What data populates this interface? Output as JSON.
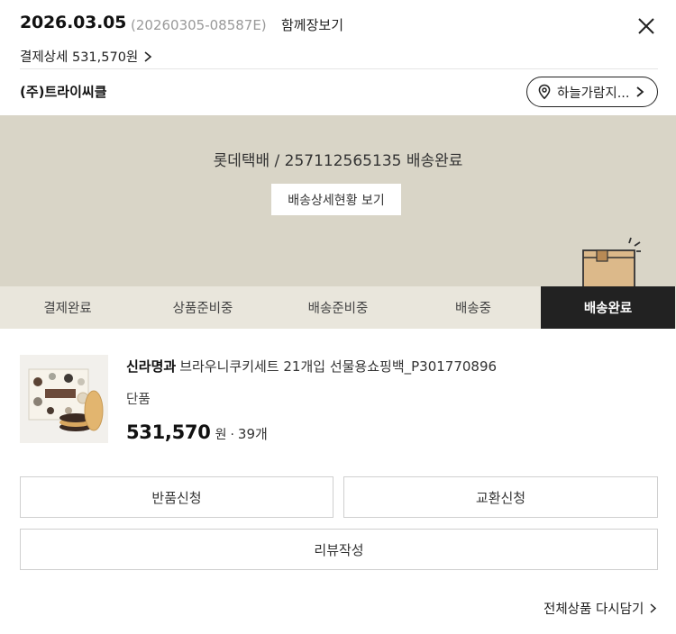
{
  "header": {
    "date": "2026.03.05",
    "order_number": "(20260305-08587E)",
    "together_label": "함께장보기",
    "payment_detail": "결제상세 531,570원"
  },
  "seller": {
    "name": "(주)트라이씨클",
    "location": "하늘가람지..."
  },
  "delivery": {
    "tracking_text": "롯데택배 / 257112565135 배송완료",
    "detail_button": "배송상세현황 보기"
  },
  "steps": {
    "items": [
      "결제완료",
      "상품준비중",
      "배송준비중",
      "배송중",
      "배송완료"
    ],
    "active_index": 4
  },
  "product": {
    "brand": "신라명과",
    "name": "브라우니쿠키세트 21개입 선물용쇼핑백_P301770896",
    "option": "단품",
    "price": "531,570",
    "currency": "원",
    "separator": "·",
    "quantity": "39개"
  },
  "actions": {
    "return_label": "반품신청",
    "exchange_label": "교환신청",
    "review_label": "리뷰작성",
    "cart_again_label": "전체상품 다시담기"
  },
  "colors": {
    "banner_bg": "#d9d5c7",
    "steps_bg": "#e9e6dc",
    "active_step_bg": "#222222"
  }
}
